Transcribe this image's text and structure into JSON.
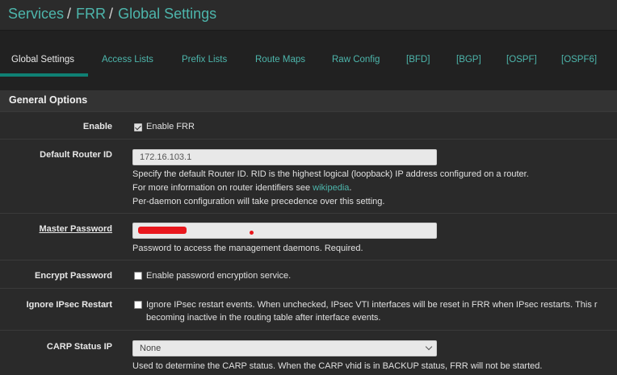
{
  "breadcrumb": {
    "items": [
      "Services",
      "FRR",
      "Global Settings"
    ],
    "separator": "/"
  },
  "tabs": [
    {
      "label": "Global Settings",
      "active": true
    },
    {
      "label": "Access Lists",
      "active": false
    },
    {
      "label": "Prefix Lists",
      "active": false
    },
    {
      "label": "Route Maps",
      "active": false
    },
    {
      "label": "Raw Config",
      "active": false
    },
    {
      "label": "[BFD]",
      "active": false
    },
    {
      "label": "[BGP]",
      "active": false
    },
    {
      "label": "[OSPF]",
      "active": false
    },
    {
      "label": "[OSPF6]",
      "active": false
    }
  ],
  "section": {
    "title": "General Options"
  },
  "fields": {
    "enable": {
      "label": "Enable",
      "checkbox_label": "Enable FRR",
      "checked": true
    },
    "router_id": {
      "label": "Default Router ID",
      "value": "172.16.103.1",
      "help_1": "Specify the default Router ID. RID is the highest logical (loopback) IP address configured on a router.",
      "help_2_prefix": "For more information on router identifiers see ",
      "help_2_link": "wikipedia",
      "help_2_suffix": ".",
      "help_3": "Per-daemon configuration will take precedence over this setting."
    },
    "master_password": {
      "label": "Master Password",
      "help": "Password to access the management daemons. Required."
    },
    "encrypt_password": {
      "label": "Encrypt Password",
      "checkbox_label": "Enable password encryption service.",
      "checked": false
    },
    "ignore_ipsec": {
      "label": "Ignore IPsec Restart",
      "checkbox_label": "Ignore IPsec restart events. When unchecked, IPsec VTI interfaces will be reset in FRR when IPsec restarts. This r",
      "checkbox_label_2": "becoming inactive in the routing table after interface events.",
      "checked": false
    },
    "carp_status_ip": {
      "label": "CARP Status IP",
      "selected": "None",
      "help": "Used to determine the CARP status. When the CARP vhid is in BACKUP status, FRR will not be started."
    }
  },
  "colors": {
    "accent": "#4db6ac",
    "tab_underline": "#0f8074",
    "background": "#212121",
    "row_background": "#2a2a2a",
    "redaction": "#e8161c"
  }
}
